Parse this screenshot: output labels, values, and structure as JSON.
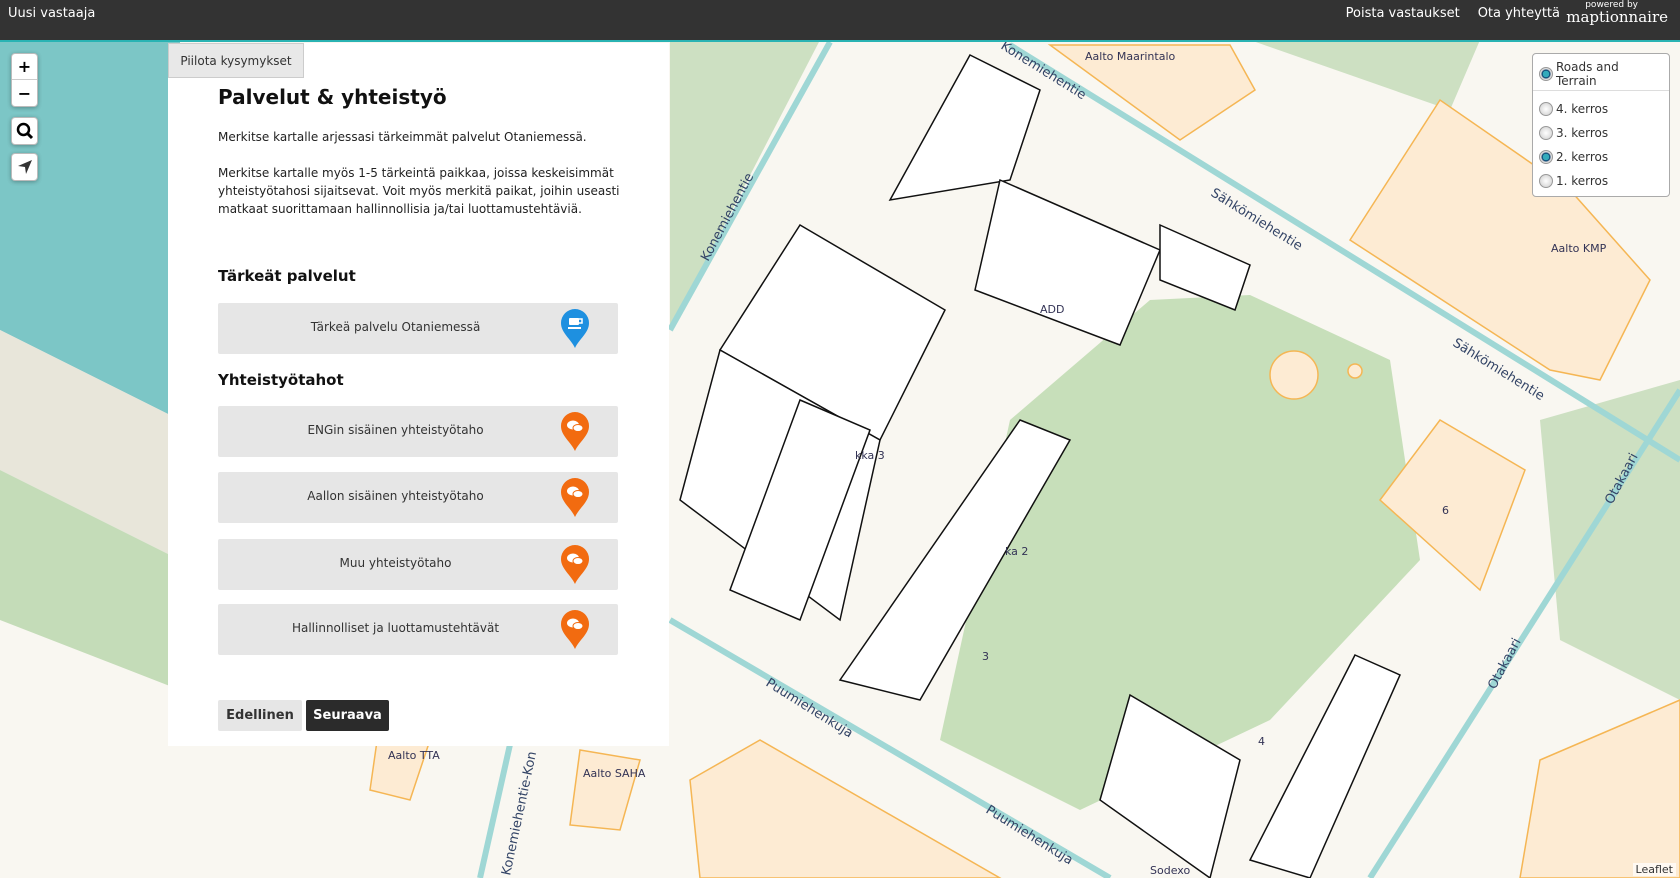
{
  "topbar": {
    "new_respondent": "Uusi vastaaja",
    "links": [
      "Poista vastaukset",
      "Ota yhteyttä"
    ],
    "logo_powered": "powered by",
    "logo_name": "maptionnaire"
  },
  "panel": {
    "hide_label": "Piilota kysymykset",
    "title": "Palvelut & yhteistyö",
    "para1": "Merkitse kartalle arjessasi tärkeimmät palvelut Otaniemessä.",
    "para2": "Merkitse kartalle myös 1-5 tärkeintä paikkaa, joissa keskeisimmät yhteistyötahosi sijaitsevat. Voit myös merkitä paikat, joihin useasti matkaat suorittamaan hallinnollisia ja/tai luottamustehtäviä.",
    "section1": "Tärkeät palvelut",
    "services": [
      {
        "label": "Tärkeä palvelu Otaniemessä",
        "icon": "coffee-marker-icon",
        "color": "#1e90e0"
      }
    ],
    "section2": "Yhteistyötahot",
    "partners": [
      {
        "label": "ENGin sisäinen yhteistyötaho",
        "icon": "chat-marker-icon",
        "color": "#f26b10"
      },
      {
        "label": "Aallon sisäinen yhteistyötaho",
        "icon": "chat-marker-icon",
        "color": "#f26b10"
      },
      {
        "label": "Muu yhteistyötaho",
        "icon": "chat-marker-icon",
        "color": "#f26b10"
      },
      {
        "label": "Hallinnolliset ja luottamustehtävät",
        "icon": "chat-marker-icon",
        "color": "#f26b10"
      }
    ],
    "prev": "Edellinen",
    "next": "Seuraava"
  },
  "layers": {
    "base": "Roads and Terrain",
    "floors": [
      "4. kerros",
      "3. kerros",
      "2. kerros",
      "1. kerros"
    ],
    "selected_floor": "2. kerros"
  },
  "map": {
    "labels": [
      "Aalto Maarintalo",
      "Aalto KMP",
      "Aalto TTA",
      "Aalto SAHA",
      "ADD",
      "kka 3",
      "ka 2",
      "Sodexo",
      "6",
      "3",
      "4"
    ],
    "roads": [
      "Konemiehentie",
      "Sähkömiehentie",
      "Sähkömiehentie",
      "Otakaari",
      "Otakaari",
      "Puumiehenkuja",
      "Puumiehenkuja",
      "Konemiehentie-Kon",
      "Konemiehentie"
    ],
    "attribution": "Leaflet"
  }
}
